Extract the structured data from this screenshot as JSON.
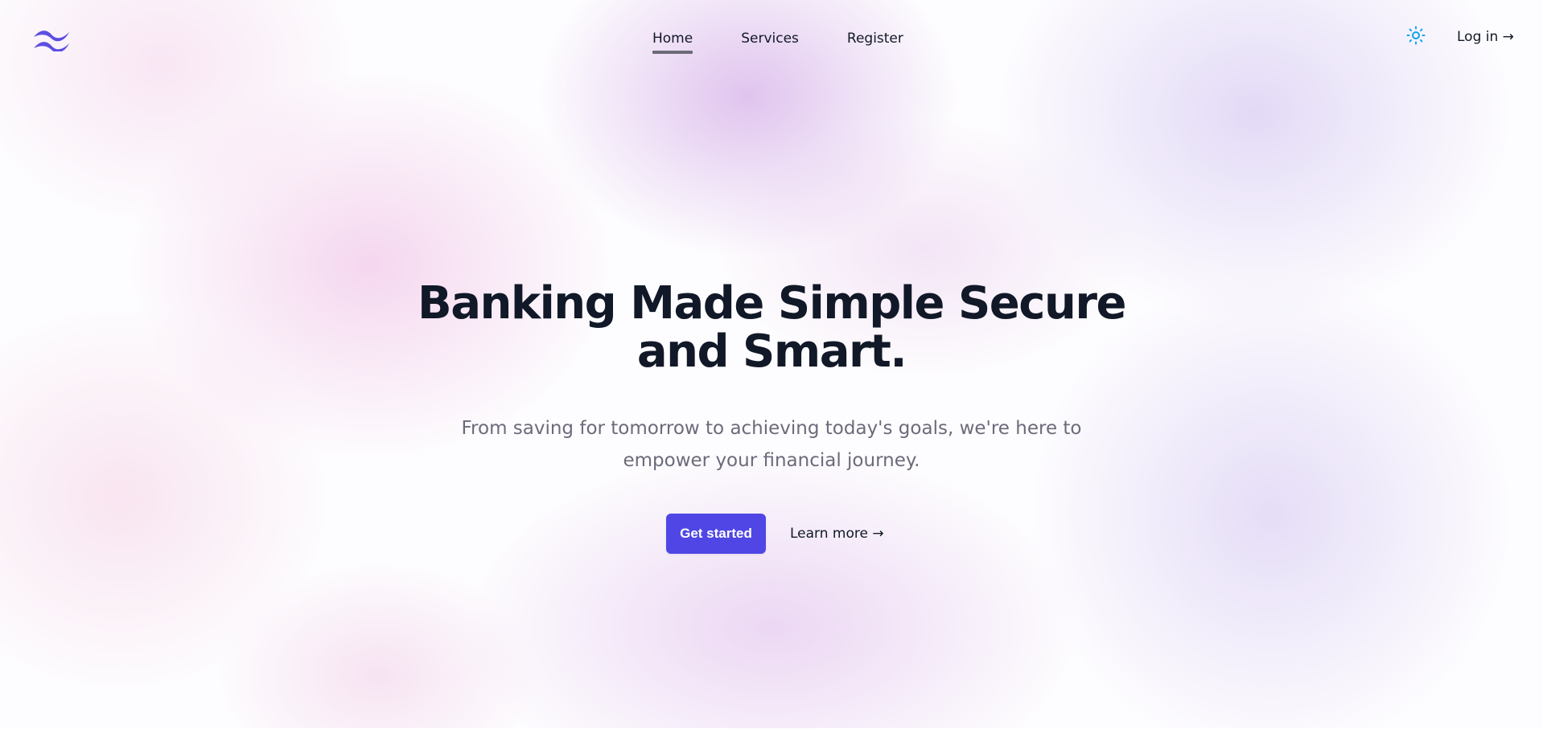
{
  "header": {
    "logo_icon": "tailwind-wave-logo-icon",
    "nav": {
      "home": "Home",
      "services": "Services",
      "register": "Register"
    },
    "theme_icon": "sun-icon",
    "login_label": "Log in →"
  },
  "hero": {
    "title": "Banking Made Simple Secure and Smart.",
    "title_line1": "Banking Made Simple Secure",
    "title_line2": "and Smart.",
    "subtitle_line1": "From saving for tomorrow to achieving today's goals, we're here to",
    "subtitle_line2": "empower your financial journey.",
    "primary_button": "Get started",
    "secondary_link": "Learn more →"
  },
  "colors": {
    "accent": "#4f46e5",
    "logo": "#5b4fe0",
    "sun_icon": "#0ea5e9",
    "heading": "#111827",
    "muted": "#6b6b7b"
  }
}
